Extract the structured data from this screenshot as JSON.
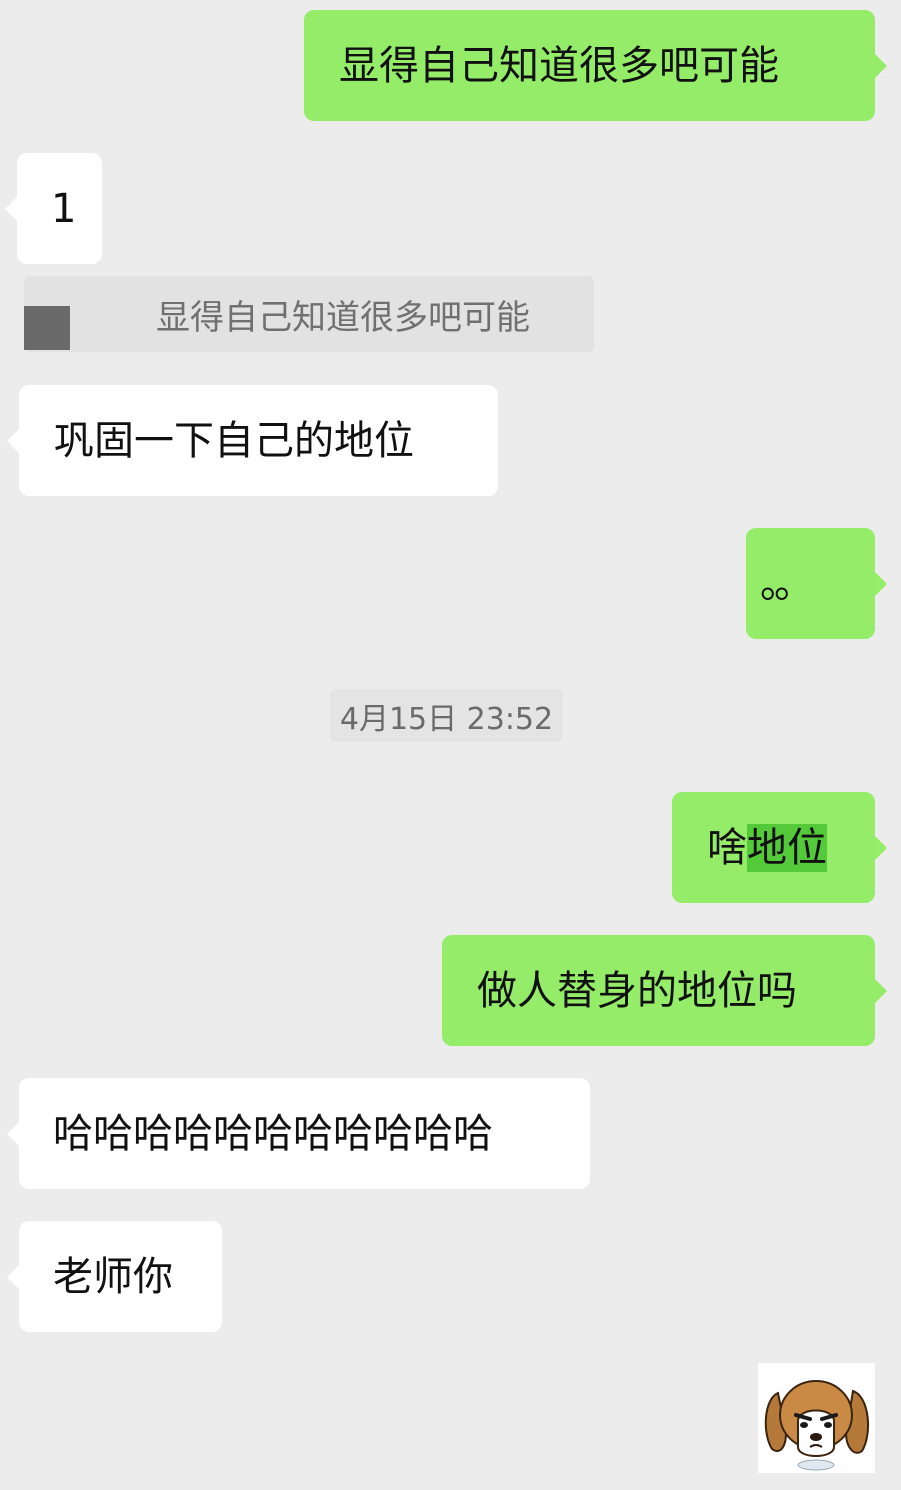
{
  "messages": [
    {
      "side": "sent",
      "text": "显得自己知道很多吧可能"
    },
    {
      "side": "received",
      "text": "1"
    },
    {
      "side": "quote",
      "text": "显得自己知道很多吧可能"
    },
    {
      "side": "received",
      "text": "巩固一下自己的地位"
    },
    {
      "side": "sent",
      "text": "。。"
    },
    {
      "side": "time",
      "text": "4月15日 23:52"
    },
    {
      "side": "sent",
      "text_plain": "啥",
      "text_highlight": "地位"
    },
    {
      "side": "sent",
      "text": "做人替身的地位吗"
    },
    {
      "side": "received",
      "text": "哈哈哈哈哈哈哈哈哈哈哈"
    },
    {
      "side": "received",
      "text": "老师你"
    },
    {
      "side": "sent",
      "sticker": "beagle-dog-sticker-icon"
    }
  ],
  "colors": {
    "background": "#ececec",
    "sent_bubble": "#95ec69",
    "received_bubble": "#ffffff",
    "highlight": "#54c93a"
  }
}
